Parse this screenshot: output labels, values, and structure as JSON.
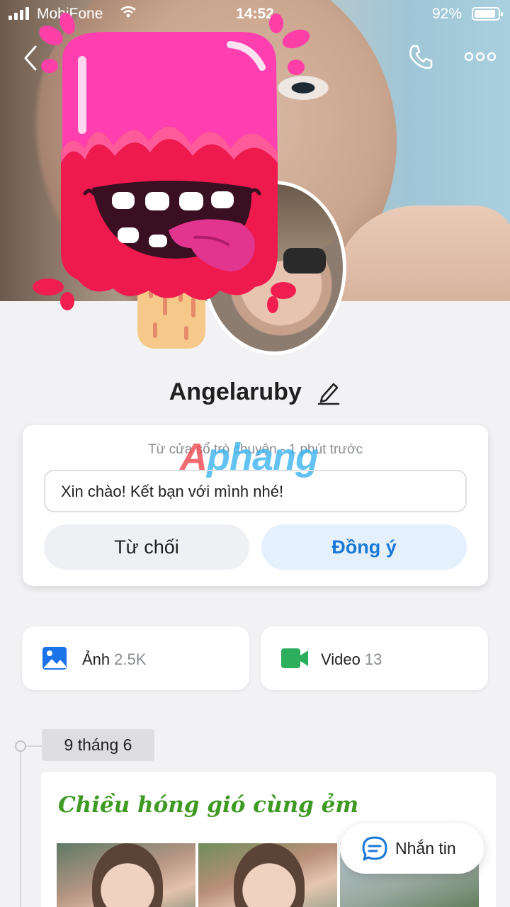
{
  "status_bar": {
    "carrier": "MobiFone",
    "time": "14:52",
    "battery_percent": "92%",
    "battery_level": 0.92
  },
  "header": {
    "back_icon": "chevron-left-icon",
    "call_icon": "phone-icon",
    "more_icon": "more-horizontal-icon"
  },
  "profile": {
    "name": "Angelaruby",
    "edit_icon": "pencil-icon"
  },
  "friend_request": {
    "source": "Từ cửa sổ trò chuyện - 1 phút trước",
    "message": "Xin chào! Kết bạn với mình nhé!",
    "decline_label": "Từ chối",
    "accept_label": "Đồng ý"
  },
  "watermark": {
    "part1": "A",
    "part2": "phang"
  },
  "media": {
    "photos": {
      "label": "Ảnh",
      "count": "2.5K",
      "icon": "image-icon",
      "color": "#1a73e8"
    },
    "videos": {
      "label": "Video",
      "count": "13",
      "icon": "video-camera-icon",
      "color": "#2dae5c"
    }
  },
  "timeline": {
    "date": "9 tháng 6",
    "post_caption": "Chiều hóng gió cùng ẻm"
  },
  "message_button": {
    "label": "Nhắn tin",
    "icon": "chat-bubble-icon"
  },
  "colors": {
    "accent_blue": "#1a78d6",
    "caption_green": "#3e9a22"
  }
}
